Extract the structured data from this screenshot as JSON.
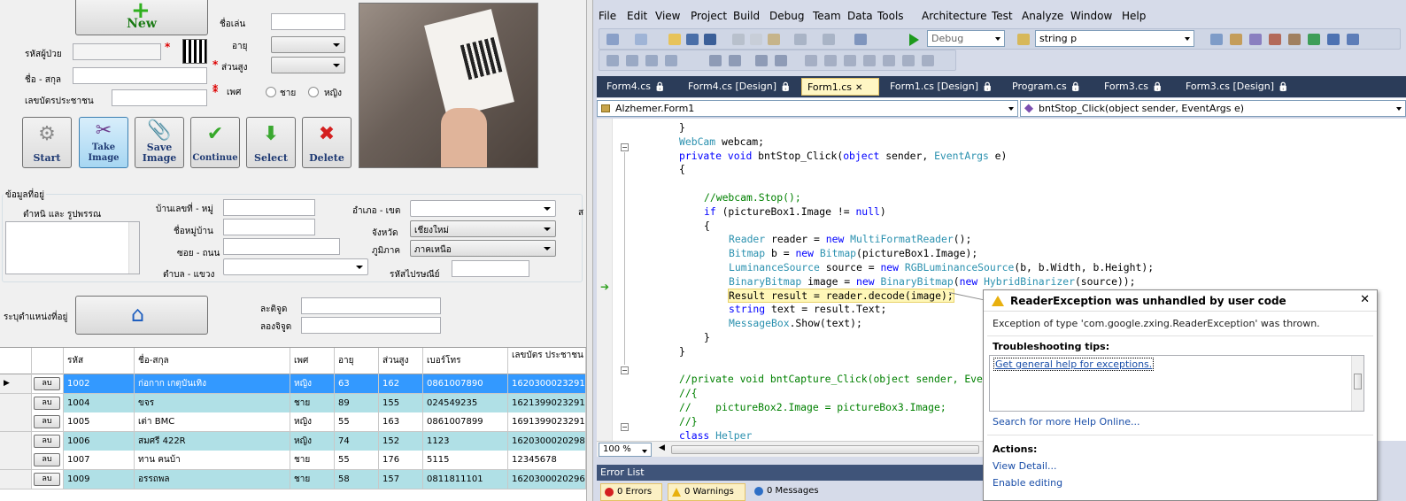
{
  "form": {
    "new_label": "New",
    "nickname_label": "ชื่อเล่น",
    "id_label": "รหัสผู้ป่วย",
    "age_label": "อายุ",
    "name_label": "ชื่อ - สกุล",
    "height_label": "ส่วนสูง",
    "citizen_label": "เลขบัตรประชาชน",
    "gender_label": "เพศ",
    "gender_male": "ชาย",
    "gender_female": "หญิง",
    "required_mark": "*",
    "buttons": [
      {
        "label": "Start",
        "icon": "gear-icon"
      },
      {
        "label": "Take Image",
        "icon": "scissors-icon"
      },
      {
        "label": "Save Image",
        "icon": "paperclip-icon"
      },
      {
        "label": "Continue",
        "icon": "checkmark-icon"
      },
      {
        "label": "Select",
        "icon": "down-arrow-icon"
      },
      {
        "label": "Delete",
        "icon": "x-icon"
      }
    ],
    "address_group": "ข้อมูลที่อยู่",
    "landmark_label": "ตำหนิ และ รูปพรรณ",
    "house_label": "บ้านเลขที่ - หมู่",
    "village_label": "ชื่อหมู่บ้าน",
    "road_label": "ซอย - ถนน",
    "subdistrict_label": "ตำบล - แขวง",
    "district_label": "อำเภอ - เขต",
    "province_label": "จังหวัด",
    "province_value": "เชียงใหม่",
    "region_label": "ภูมิภาค",
    "region_value": "ภาคเหนือ",
    "postcode_label": "รหัสไปรษณีย์",
    "location_label": "ระบุตำแหน่งที่อยู่",
    "lat_label": "ละติจูด",
    "lng_label": "ลองจิจูด",
    "side_char": "ส"
  },
  "grid": {
    "headers": [
      "รหัส",
      "ชื่อ-สกุล",
      "เพศ",
      "อายุ",
      "ส่วนสูง",
      "เบอร์โทร",
      "เลขบัตร ประชาชน"
    ],
    "delete_label": "ลบ",
    "rows": [
      [
        "1002",
        "ก่อกาก เกตุบันเทิง",
        "หญิง",
        "63",
        "162",
        "0861007890",
        "1620300023291"
      ],
      [
        "1004",
        "ขจร",
        "ชาย",
        "89",
        "155",
        "024549235",
        "1621399023291"
      ],
      [
        "1005",
        "เต่า BMC",
        "หญิง",
        "55",
        "163",
        "0861007899",
        "1691399023291"
      ],
      [
        "1006",
        "สมศรี 422R",
        "หญิง",
        "74",
        "152",
        "1123",
        "1620300020298"
      ],
      [
        "1007",
        "ทาน คนบ้า",
        "ชาย",
        "55",
        "176",
        "5115",
        "12345678"
      ],
      [
        "1009",
        "อรรถพล",
        "ชาย",
        "58",
        "157",
        "0811811101",
        "1620300020296"
      ]
    ]
  },
  "vs": {
    "menu": [
      "File",
      "Edit",
      "View",
      "Project",
      "Build",
      "Debug",
      "Team",
      "Data",
      "Tools",
      "Architecture",
      "Test",
      "Analyze",
      "Window",
      "Help"
    ],
    "config": "Debug",
    "find": "string p",
    "tabs": [
      "Form4.cs",
      "Form4.cs [Design]",
      "Form1.cs",
      "Form1.cs [Design]",
      "Program.cs",
      "Form3.cs",
      "Form3.cs [Design]"
    ],
    "nav_left": "Alzhemer.Form1",
    "nav_right": "bntStop_Click(object sender, EventArgs e)",
    "zoom": "100 %",
    "error_list_title": "Error List",
    "errors": "0 Errors",
    "warnings": "0 Warnings",
    "messages": "0 Messages"
  },
  "code": [
    {
      "i": 0,
      "t": [
        [
          "",
          "}"
        ]
      ]
    },
    {
      "i": 0,
      "t": [
        [
          "ty",
          "WebCam"
        ],
        [
          "",
          " webcam;"
        ]
      ]
    },
    {
      "i": 0,
      "t": [
        [
          "kw",
          "private"
        ],
        [
          "",
          " "
        ],
        [
          "kw",
          "void"
        ],
        [
          "",
          " bntStop_Click("
        ],
        [
          "kw",
          "object"
        ],
        [
          "",
          " sender, "
        ],
        [
          "ty",
          "EventArgs"
        ],
        [
          "",
          " e)"
        ]
      ]
    },
    {
      "i": 0,
      "t": [
        [
          "",
          "{"
        ]
      ]
    },
    {
      "i": 0,
      "t": [
        [
          "",
          ""
        ]
      ]
    },
    {
      "i": 1,
      "t": [
        [
          "cm",
          "//webcam.Stop();"
        ]
      ]
    },
    {
      "i": 1,
      "t": [
        [
          "kw",
          "if"
        ],
        [
          "",
          " (pictureBox1.Image != "
        ],
        [
          "kw",
          "null"
        ],
        [
          "",
          ")"
        ]
      ]
    },
    {
      "i": 1,
      "t": [
        [
          "",
          "{"
        ]
      ]
    },
    {
      "i": 2,
      "t": [
        [
          "ty",
          "Reader"
        ],
        [
          "",
          " reader = "
        ],
        [
          "kw",
          "new"
        ],
        [
          "",
          " "
        ],
        [
          "ty",
          "MultiFormatReader"
        ],
        [
          "",
          "();"
        ]
      ]
    },
    {
      "i": 2,
      "t": [
        [
          "ty",
          "Bitmap"
        ],
        [
          "",
          " b = "
        ],
        [
          "kw",
          "new"
        ],
        [
          "",
          " "
        ],
        [
          "ty",
          "Bitmap"
        ],
        [
          "",
          "(pictureBox1.Image);"
        ]
      ]
    },
    {
      "i": 2,
      "t": [
        [
          "ty",
          "LuminanceSource"
        ],
        [
          "",
          " source = "
        ],
        [
          "kw",
          "new"
        ],
        [
          "",
          " "
        ],
        [
          "ty",
          "RGBLuminanceSource"
        ],
        [
          "",
          "(b, b.Width, b.Height);"
        ]
      ]
    },
    {
      "i": 2,
      "t": [
        [
          "ty",
          "BinaryBitmap"
        ],
        [
          "",
          " image = "
        ],
        [
          "kw",
          "new"
        ],
        [
          "",
          " "
        ],
        [
          "ty",
          "BinaryBitmap"
        ],
        [
          "",
          "("
        ],
        [
          "kw",
          "new"
        ],
        [
          "",
          " "
        ],
        [
          "ty",
          "HybridBinarizer"
        ],
        [
          "",
          "(source));"
        ]
      ]
    },
    {
      "i": 2,
      "t": [
        [
          "hl",
          "Result result = reader.decode(image);"
        ]
      ]
    },
    {
      "i": 2,
      "t": [
        [
          "kw",
          "string"
        ],
        [
          "",
          " text = result.Text;"
        ]
      ]
    },
    {
      "i": 2,
      "t": [
        [
          "ty",
          "MessageBox"
        ],
        [
          "",
          ".Show(text);"
        ]
      ]
    },
    {
      "i": 1,
      "t": [
        [
          "",
          "}"
        ]
      ]
    },
    {
      "i": 0,
      "t": [
        [
          "",
          "}"
        ]
      ]
    },
    {
      "i": 0,
      "t": [
        [
          "",
          ""
        ]
      ]
    },
    {
      "i": 0,
      "t": [
        [
          "cm",
          "//private void bntCapture_Click(object sender, Eve"
        ]
      ]
    },
    {
      "i": 0,
      "t": [
        [
          "cm",
          "//{"
        ]
      ]
    },
    {
      "i": 0,
      "t": [
        [
          "cm",
          "//    pictureBox2.Image = pictureBox3.Image;"
        ]
      ]
    },
    {
      "i": 0,
      "t": [
        [
          "cm",
          "//}"
        ]
      ]
    },
    {
      "i": 0,
      "t": [
        [
          "kw",
          "class"
        ],
        [
          "",
          " "
        ],
        [
          "ty",
          "Helper"
        ]
      ]
    },
    {
      "i": 0,
      "t": [
        [
          "",
          "{"
        ]
      ]
    }
  ],
  "exception": {
    "title": "ReaderException was unhandled by user code",
    "message": "Exception of type 'com.google.zxing.ReaderException' was thrown.",
    "tips_header": "Troubleshooting tips:",
    "tip_link": "Get general help for exceptions.",
    "search_link": "Search for more Help Online...",
    "actions_header": "Actions:",
    "view_detail": "View Detail...",
    "enable_editing": "Enable editing"
  }
}
